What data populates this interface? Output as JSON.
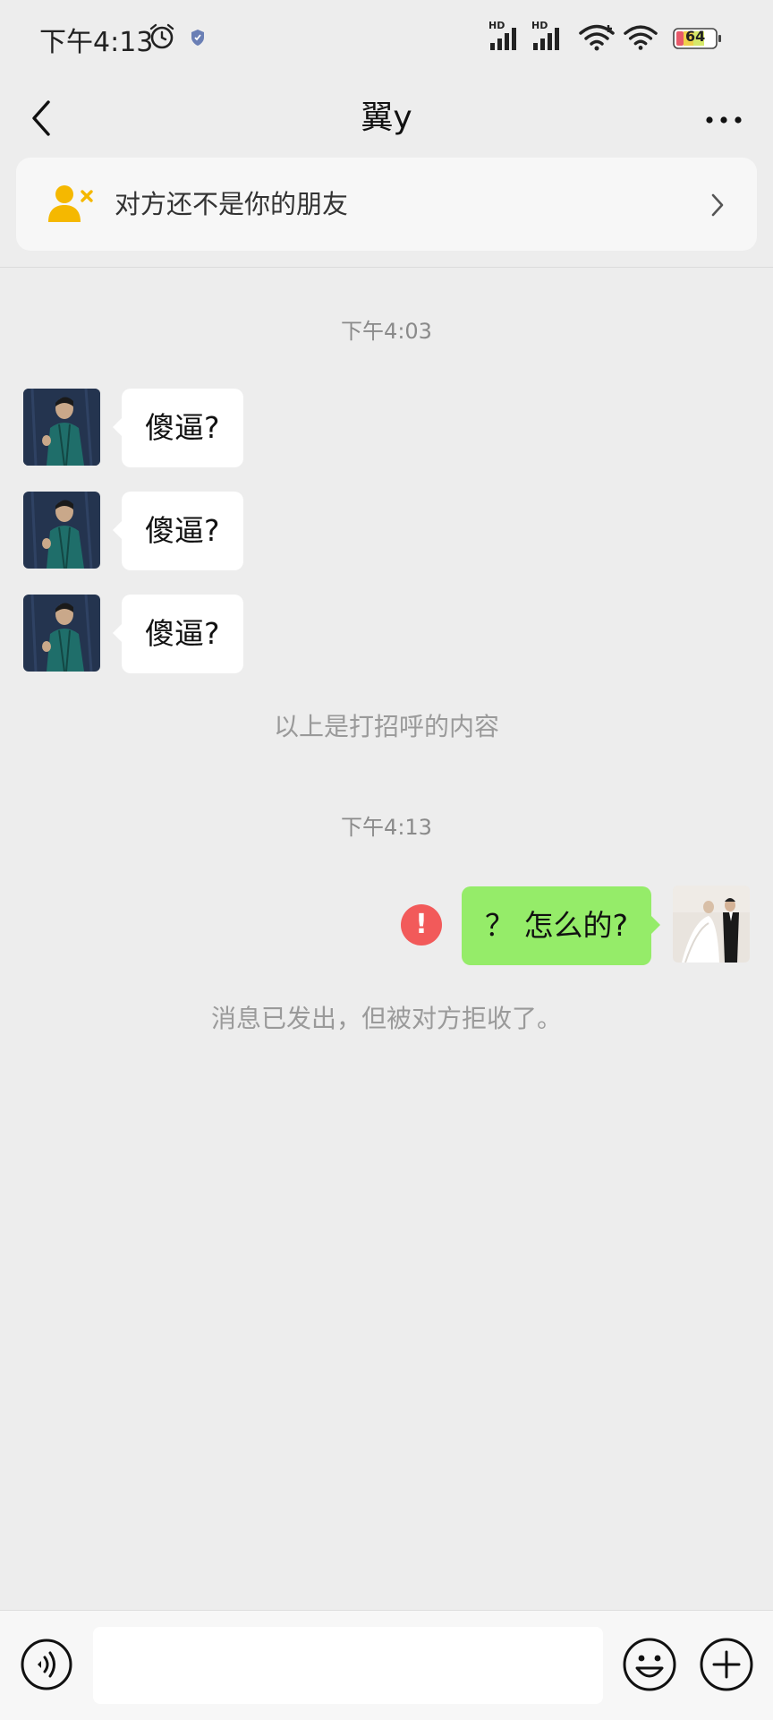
{
  "status_bar": {
    "time": "下午4:13",
    "hd_1": "HD",
    "hd_2": "HD",
    "battery": "64",
    "icons": [
      "alarm-icon",
      "shield-icon",
      "signal-icon",
      "wifi-icon",
      "battery-icon"
    ]
  },
  "header": {
    "title": "翼y"
  },
  "banner": {
    "text": "对方还不是你的朋友"
  },
  "chat": {
    "timestamp_1": "下午4:03",
    "incoming": [
      {
        "text": "傻逼?"
      },
      {
        "text": "傻逼?"
      },
      {
        "text": "傻逼?"
      }
    ],
    "greeting_note": "以上是打招呼的内容",
    "timestamp_2": "下午4:13",
    "outgoing": [
      {
        "text": "？ 怎么的?",
        "status": "failed"
      }
    ],
    "rejected_note": "消息已发出，但被对方拒收了。"
  },
  "input_bar": {
    "input_value": "",
    "icons": [
      "voice-icon",
      "emoji-icon",
      "plus-icon"
    ]
  },
  "colors": {
    "background": "#ededed",
    "outgoing_bubble": "#95ec69",
    "incoming_bubble": "#ffffff",
    "error": "#f25a5a",
    "accent_banner_icon": "#f5b800"
  }
}
